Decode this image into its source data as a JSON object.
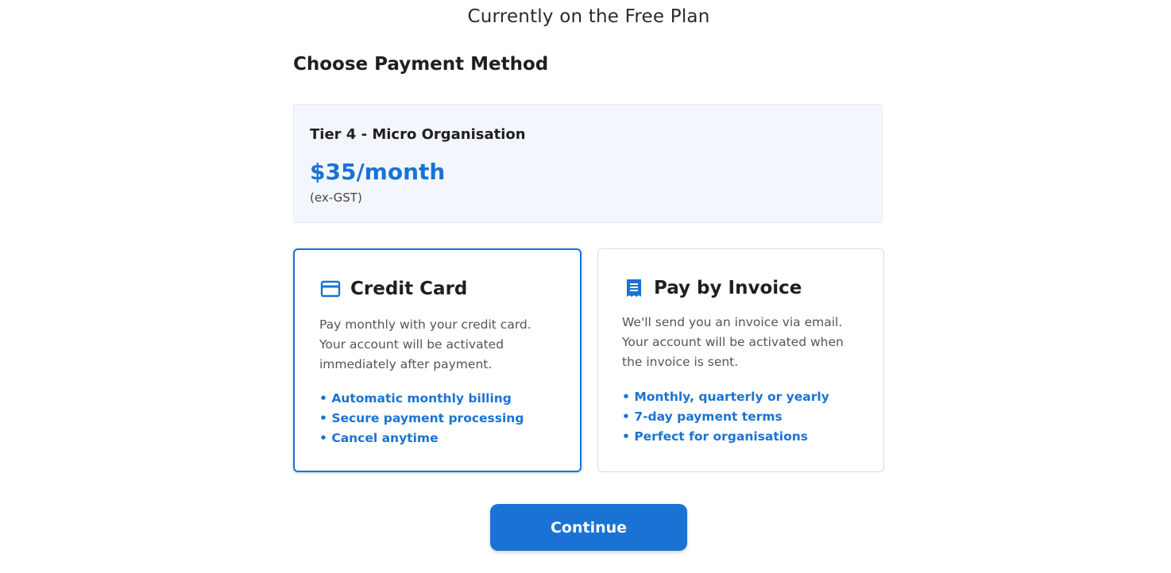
{
  "header": {
    "current_plan": "Currently on the Free Plan",
    "section_title": "Choose Payment Method"
  },
  "plan": {
    "name": "Tier 4 - Micro Organisation",
    "price": "$35/month",
    "tax_note": "(ex-GST)"
  },
  "options": {
    "credit_card": {
      "icon": "credit-card-icon",
      "title": "Credit Card",
      "description": "Pay monthly with your credit card. Your account will be activated immediately after payment.",
      "features": [
        "Automatic monthly billing",
        "Secure payment processing",
        "Cancel anytime"
      ],
      "selected": true
    },
    "invoice": {
      "icon": "invoice-icon",
      "title": "Pay by Invoice",
      "description": "We'll send you an invoice via email. Your account will be activated when the invoice is sent.",
      "features": [
        "Monthly, quarterly or yearly",
        "7-day payment terms",
        "Perfect for organisations"
      ],
      "selected": false
    }
  },
  "actions": {
    "continue_label": "Continue"
  },
  "colors": {
    "accent": "#1a73d4",
    "plan_background": "#f3f7fd"
  }
}
